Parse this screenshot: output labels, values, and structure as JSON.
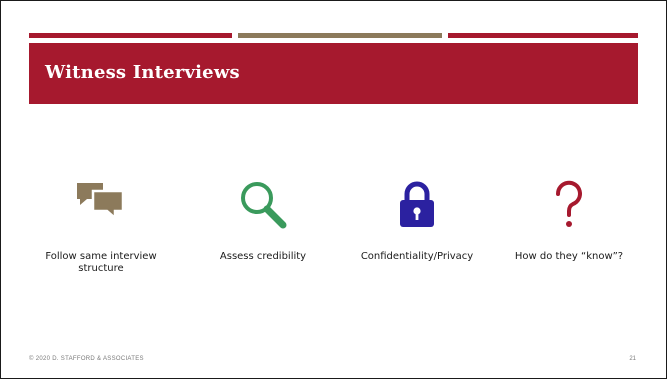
{
  "slide": {
    "title": "Witness Interviews",
    "items": [
      {
        "icon": "speech-bubbles-icon",
        "label": "Follow same interview structure"
      },
      {
        "icon": "magnifying-glass-icon",
        "label": "Assess credibility"
      },
      {
        "icon": "padlock-icon",
        "label": "Confidentiality/Privacy"
      },
      {
        "icon": "question-mark-icon",
        "label": "How do they “know”?"
      }
    ],
    "footer": {
      "copyright": "© 2020 D. STAFFORD & ASSOCIATES",
      "page_number": "21"
    }
  },
  "colors": {
    "accent_red": "#a6192e",
    "accent_tan": "#8c7a5b",
    "chat_icon": "#8c7a5b",
    "search_icon": "#3a9a5c",
    "lock_icon": "#2b21a0",
    "question_icon": "#a6192e"
  }
}
